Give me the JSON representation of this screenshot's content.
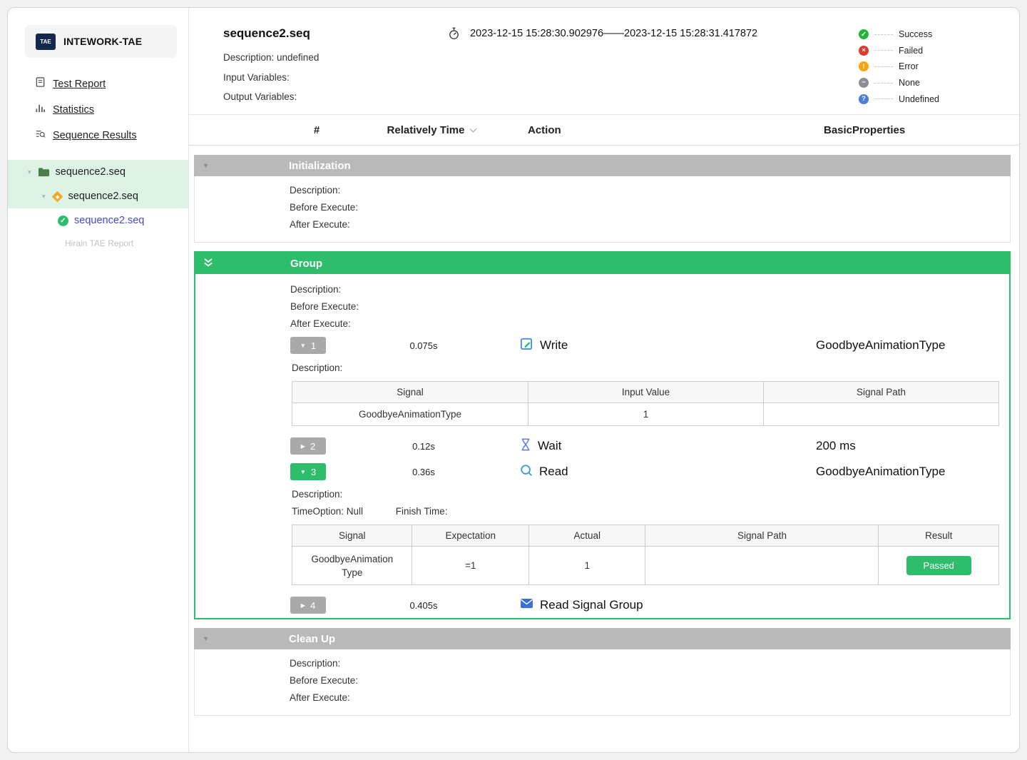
{
  "colors": {
    "green": "#2dbd6b",
    "section-gray": "#b9b9b9",
    "badge-gray": "#a9a9a9",
    "row-green": "#dcf2e4",
    "blue-link": "#4646d8",
    "success": "#27b43e",
    "failed": "#e03a2f",
    "error": "#f5a50b",
    "none": "#8a8f96",
    "undef": "#4a7de0"
  },
  "sidebar": {
    "logo_text": "TAE",
    "app_name": "INTEWORK-TAE",
    "menu": [
      {
        "label": "Test Report"
      },
      {
        "label": "Statistics"
      },
      {
        "label": "Sequence Results"
      }
    ],
    "tree": [
      {
        "label": "sequence2.seq"
      },
      {
        "label": "sequence2.seq"
      },
      {
        "label": "sequence2.seq"
      }
    ],
    "footer": "Hirain TAE Report"
  },
  "header": {
    "title": "sequence2.seq",
    "time_range": "2023-12-15 15:28:30.902976——2023-12-15 15:28:31.417872",
    "description": "Description: undefined",
    "input_variables": "Input Variables:",
    "output_variables": "Output Variables:",
    "legend": [
      {
        "symbol": "✓",
        "label": "Success"
      },
      {
        "symbol": "×",
        "label": "Failed"
      },
      {
        "symbol": "!",
        "label": "Error"
      },
      {
        "symbol": "−",
        "label": "None"
      },
      {
        "symbol": "?",
        "label": "Undefined"
      }
    ]
  },
  "columns": {
    "num": "#",
    "time": "Relatively Time",
    "action": "Action",
    "props": "BasicProperties"
  },
  "sections": {
    "initialization": {
      "title": "Initialization",
      "description": "Description:",
      "before_execute": "Before Execute:",
      "after_execute": "After Execute:"
    },
    "group": {
      "title": "Group",
      "description": "Description:",
      "before_execute": "Before Execute:",
      "after_execute": "After Execute:",
      "steps": [
        {
          "num": "1",
          "time": "0.075s",
          "action": "Write",
          "props": "GoodbyeAnimationType",
          "description": "Description:",
          "table": {
            "headers": [
              "Signal",
              "Input Value",
              "Signal Path"
            ],
            "rows": [
              [
                "GoodbyeAnimationType",
                "1",
                ""
              ]
            ]
          }
        },
        {
          "num": "2",
          "time": "0.12s",
          "action": "Wait",
          "props": "200 ms"
        },
        {
          "num": "3",
          "time": "0.36s",
          "action": "Read",
          "props": "GoodbyeAnimationType",
          "description": "Description:",
          "time_option": "TimeOption: Null",
          "finish_time": "Finish Time:",
          "table": {
            "headers": [
              "Signal",
              "Expectation",
              "Actual",
              "Signal Path",
              "Result"
            ],
            "rows": [
              [
                "GoodbyeAnimationType",
                "=1",
                "1",
                "",
                "Passed"
              ]
            ]
          }
        },
        {
          "num": "4",
          "time": "0.405s",
          "action": "Read Signal Group",
          "props": ""
        }
      ]
    },
    "cleanup": {
      "title": "Clean Up",
      "description": "Description:",
      "before_execute": "Before Execute:",
      "after_execute": "After Execute:"
    }
  }
}
